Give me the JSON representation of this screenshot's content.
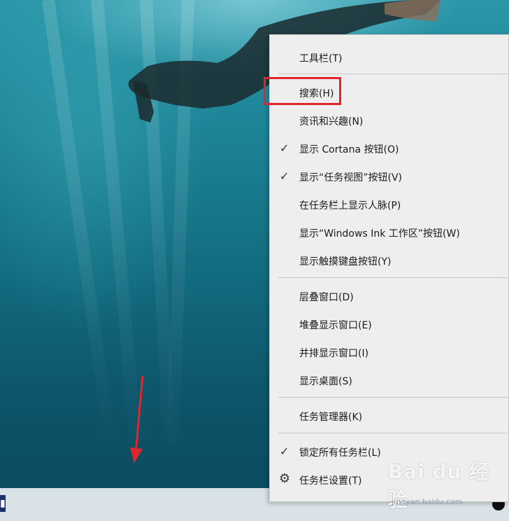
{
  "context_menu": {
    "items": [
      {
        "label": "工具栏(T)",
        "checked": false
      },
      {
        "label": "搜索(H)",
        "checked": false
      },
      {
        "label": "资讯和兴趣(N)",
        "checked": false
      },
      {
        "label": "显示 Cortana 按钮(O)",
        "checked": true
      },
      {
        "label": "显示“任务视图”按钮(V)",
        "checked": true
      },
      {
        "label": "在任务栏上显示人脉(P)",
        "checked": false
      },
      {
        "label": "显示“Windows Ink 工作区”按钮(W)",
        "checked": false
      },
      {
        "label": "显示触摸键盘按钮(Y)",
        "checked": false
      },
      {
        "label": "层叠窗口(D)",
        "checked": false
      },
      {
        "label": "堆叠显示窗口(E)",
        "checked": false
      },
      {
        "label": "并排显示窗口(I)",
        "checked": false
      },
      {
        "label": "显示桌面(S)",
        "checked": false
      },
      {
        "label": "任务管理器(K)",
        "checked": false
      },
      {
        "label": "锁定所有任务栏(L)",
        "checked": true
      },
      {
        "label": "任务栏设置(T)",
        "checked": false,
        "icon": "gear-icon"
      }
    ],
    "check_glyph": "✓",
    "gear_glyph": "⚙"
  },
  "taskbar": {
    "chevron_glyph": "^"
  },
  "watermark": {
    "logo": "Bai du 经验",
    "url": "jingyan.baidu.com"
  },
  "colors": {
    "highlight": "#e0262b",
    "arrow": "#e0262b",
    "menu_bg": "#eeeeee"
  }
}
